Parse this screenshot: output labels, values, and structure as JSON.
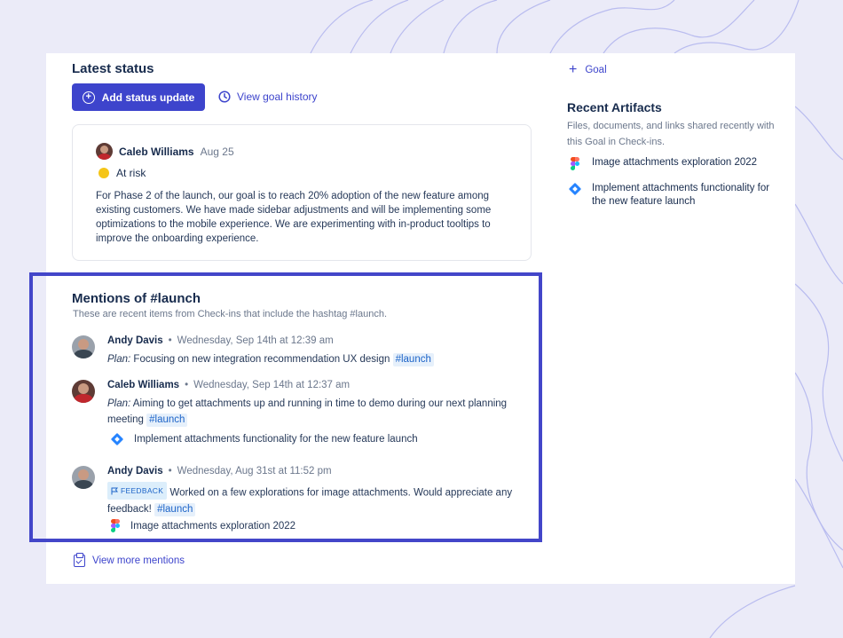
{
  "latest_status": {
    "title": "Latest status",
    "add_button": "Add status update",
    "history_link": "View goal history",
    "card": {
      "author": "Caleb Williams",
      "date": "Aug 25",
      "status": "At risk",
      "status_color": "#f5c518",
      "body": "For Phase 2 of the launch, our goal is to reach 20% adoption of the new feature among existing customers. We have made sidebar adjustments and will be implementing some optimizations to the mobile experience. We are experimenting with in-product tooltips to improve the onboarding experience."
    }
  },
  "mentions": {
    "title": "Mentions of #launch",
    "subtitle": "These are recent items from Check-ins that include the hashtag #launch.",
    "items": [
      {
        "author": "Andy Davis",
        "separator": "•",
        "time": "Wednesday, Sep 14th at 12:39 am",
        "label": "Plan:",
        "text": "Focusing on new integration recommendation UX design",
        "tag": "#launch"
      },
      {
        "author": "Caleb Williams",
        "separator": "•",
        "time": "Wednesday, Sep 14th at 12:37 am",
        "label": "Plan:",
        "text": "Aiming to get attachments up and running in time to demo during our next planning meeting",
        "tag": "#launch",
        "artifact": "Implement attachments functionality for the new feature launch",
        "artifact_icon": "jira-icon"
      },
      {
        "author": "Andy Davis",
        "separator": "•",
        "time": "Wednesday, Aug 31st at 11:52 pm",
        "badge": "FEEDBACK",
        "text": "Worked on a few explorations for image attachments. Would appreciate any feedback!",
        "tag": "#launch",
        "artifact": "Image attachments exploration 2022",
        "artifact_icon": "figma-icon"
      }
    ],
    "view_more": "View more mentions"
  },
  "sidebar": {
    "goal_link": "Goal",
    "artifacts_title": "Recent Artifacts",
    "artifacts_subtitle": "Files, documents, and links shared recently with this Goal in Check-ins.",
    "artifacts": [
      {
        "label": "Image attachments exploration 2022",
        "icon": "figma-icon"
      },
      {
        "label": "Implement attachments functionality for the new feature launch",
        "icon": "jira-icon"
      }
    ]
  },
  "colors": {
    "accent": "#3d44cc",
    "highlight_border": "#4346c9",
    "background": "#ebebf8",
    "tag_bg": "#e6f0fb"
  }
}
